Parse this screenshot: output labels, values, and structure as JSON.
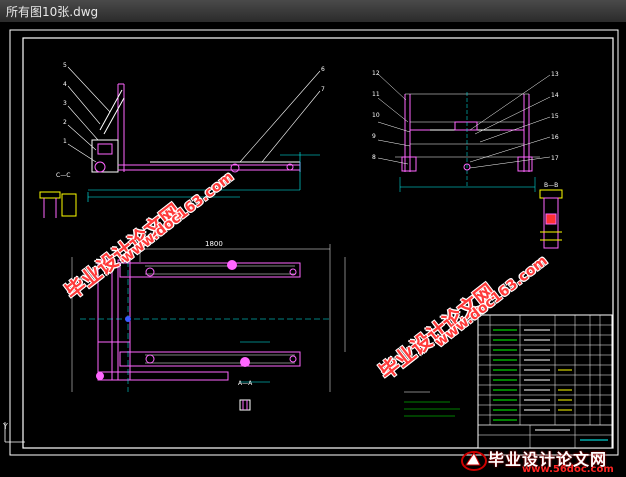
{
  "window": {
    "title": "所有图10张.dwg"
  },
  "drawing": {
    "section_labels": {
      "cc": "C—C",
      "bb": "B—B",
      "aa": "A—A"
    },
    "dimension_1800": "1800",
    "side_view_callouts": [
      "5",
      "4",
      "3",
      "2",
      "1"
    ],
    "top_callouts": [
      "6",
      "7"
    ],
    "end_view_callouts_left": [
      "12",
      "11",
      "10",
      "9",
      "8"
    ],
    "end_view_callouts_right": [
      "13",
      "14",
      "15",
      "16",
      "17"
    ]
  },
  "watermarks": {
    "cn": "毕业设计论文网",
    "url": "www.doc163.com"
  },
  "logo": {
    "cn": "毕业设计论文网",
    "url": "www.56doc.com"
  },
  "axis_indicator": "Y"
}
